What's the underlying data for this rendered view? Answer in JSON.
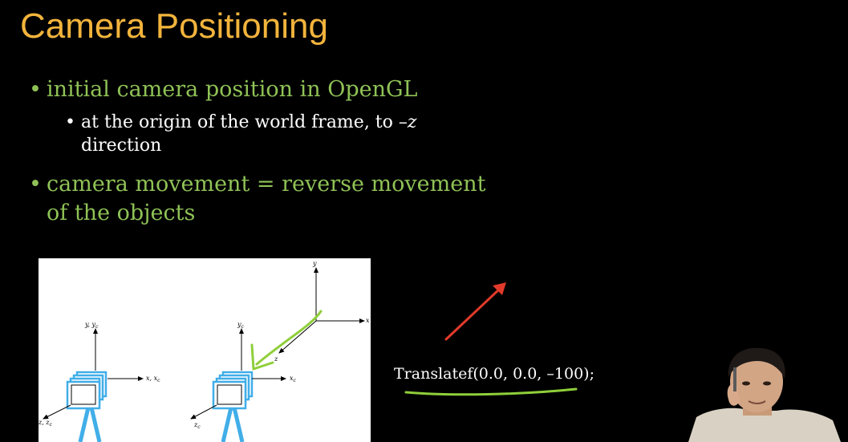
{
  "title": "Camera Positioning",
  "bullets": [
    {
      "text": "initial camera position in OpenGL",
      "sub_line1": "at the origin of the world frame, to –",
      "sub_var": "z",
      "sub_line2": "direction"
    },
    {
      "line1": "camera movement = reverse movement",
      "line2": "of the objects"
    }
  ],
  "bullet_glyph": "•",
  "figure": {
    "left_axes": {
      "y": "y, y",
      "y_sub": "c",
      "x": "x, x",
      "x_sub": "c",
      "z": "z, z",
      "z_sub": "c"
    },
    "right_axes": {
      "y_world": "y",
      "x_world": "x",
      "z_world": "z",
      "y_cam": "y",
      "y_cam_sub": "c",
      "x_cam": "x",
      "x_cam_sub": "c",
      "z_cam": "z",
      "z_cam_sub": "c"
    }
  },
  "code_text": "Translatef(0.0, 0.0, –100);",
  "colors": {
    "title": "#f3b43c",
    "bullet": "#8fc256",
    "annotation_red": "#e23a2a",
    "annotation_green": "#8fcf3a",
    "camera_blue": "#41aee8"
  }
}
